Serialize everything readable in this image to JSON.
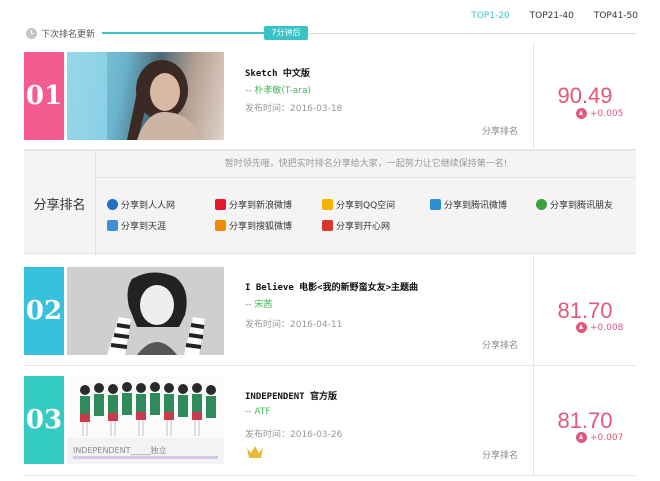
{
  "tabs": [
    {
      "label": "TOP1-20",
      "active": true
    },
    {
      "label": "TOP21-40",
      "active": false
    },
    {
      "label": "TOP41-50",
      "active": false
    }
  ],
  "timer": {
    "label": "下次排名更新",
    "badge": "7分钟后",
    "progress_fraction": 0.3
  },
  "rankings": [
    {
      "rank": "01",
      "rank_color": "#f45b8e",
      "title": "Sketch 中文版",
      "artist_prefix": "-- ",
      "artist": "朴孝敏(T-ara)",
      "release": "发布时间：2016-03-18",
      "share_label": "分享排名",
      "score": "90.49",
      "delta": "+0.005"
    },
    {
      "rank": "02",
      "rank_color": "#36c1dc",
      "title": "I Believe 电影<我的新野蛮女友>主题曲",
      "artist_prefix": "-- ",
      "artist": "宋茜",
      "release": "发布时间：2016-04-11",
      "share_label": "分享排名",
      "score": "81.70",
      "delta": "+0.008"
    },
    {
      "rank": "03",
      "rank_color": "#34cbc0",
      "title": "INDEPENDENT 官方版",
      "artist_prefix": "-- ",
      "artist": "ATF",
      "release": "发布时间：2016-03-26",
      "share_label": "分享排名",
      "score": "81.70",
      "delta": "+0.007",
      "cover_text": "INDEPENDENT_____独立"
    }
  ],
  "share_panel": {
    "title": "分享排名",
    "tip": "暂时领先哦，快把实时排名分享给大家，一起努力让它继续保持第一名!",
    "items": [
      {
        "label": "分享到人人网",
        "icon": "renren-icon",
        "color": "#1f6fc3"
      },
      {
        "label": "分享到新浪微博",
        "icon": "weibo-icon",
        "color": "#e6162d"
      },
      {
        "label": "分享到QQ空间",
        "icon": "qzone-icon",
        "color": "#f5b300"
      },
      {
        "label": "分享到腾讯微博",
        "icon": "tencent-weibo-icon",
        "color": "#2b8fd3"
      },
      {
        "label": "分享到腾讯朋友",
        "icon": "tencent-pengyou-icon",
        "color": "#3aa23a"
      },
      {
        "label": "分享到天涯",
        "icon": "tianya-icon",
        "color": "#3f8fd8"
      },
      {
        "label": "分享到搜狐微博",
        "icon": "sohu-weibo-icon",
        "color": "#f08a00"
      },
      {
        "label": "分享到开心网",
        "icon": "kaixin-icon",
        "color": "#d9362b"
      }
    ]
  }
}
